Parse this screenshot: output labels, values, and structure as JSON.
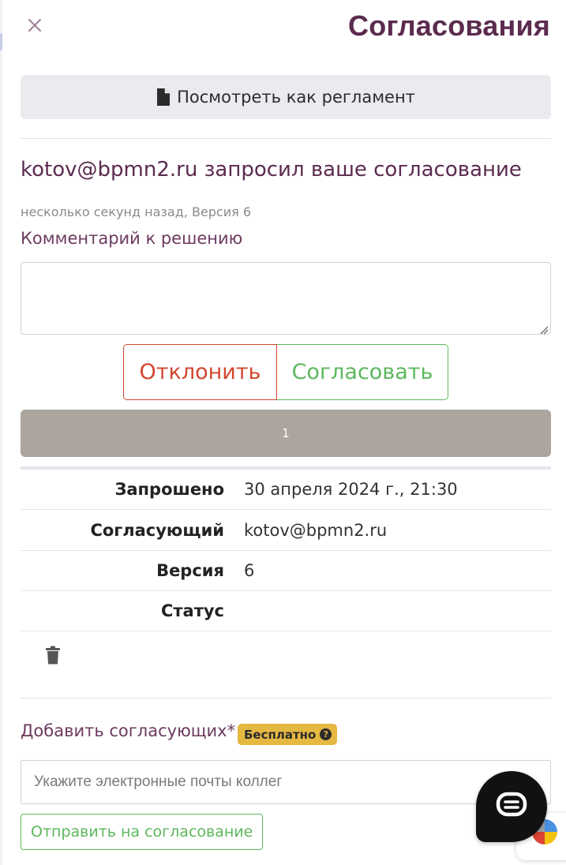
{
  "header": {
    "title": "Согласования",
    "close_icon": "close-icon",
    "accent_color": "#5c2b4f"
  },
  "view_button": {
    "label": "Посмотреть как регламент",
    "icon": "file-icon"
  },
  "request": {
    "title": "kotov@bpmn2.ru запросил ваше согласование",
    "meta": "несколько секунд назад, Версия 6",
    "comment_label": "Комментарий к решению",
    "comment_value": ""
  },
  "decision": {
    "reject_label": "Отклонить",
    "approve_label": "Согласовать",
    "reject_color": "#d2462f",
    "approve_color": "#5cb85c"
  },
  "progress": {
    "label": "1",
    "fill_fraction": 1.0,
    "color": "#aba59e"
  },
  "details": [
    {
      "key": "Запрошено",
      "value": "30 апреля 2024 г., 21:30"
    },
    {
      "key": "Согласующий",
      "value": "kotov@bpmn2.ru"
    },
    {
      "key": "Версия",
      "value": "6"
    },
    {
      "key": "Статус",
      "value": ""
    }
  ],
  "delete_icon": "trash-icon",
  "add_approvers": {
    "label": "Добавить согласующих*",
    "badge": "Бесплатно",
    "badge_icon": "question-circle-icon",
    "badge_color": "#e5b842",
    "input_value": "",
    "input_placeholder": "Укажите электронные почты коллег",
    "send_label": "Отправить на согласование"
  },
  "chat_widget_icon": "chat-icon"
}
